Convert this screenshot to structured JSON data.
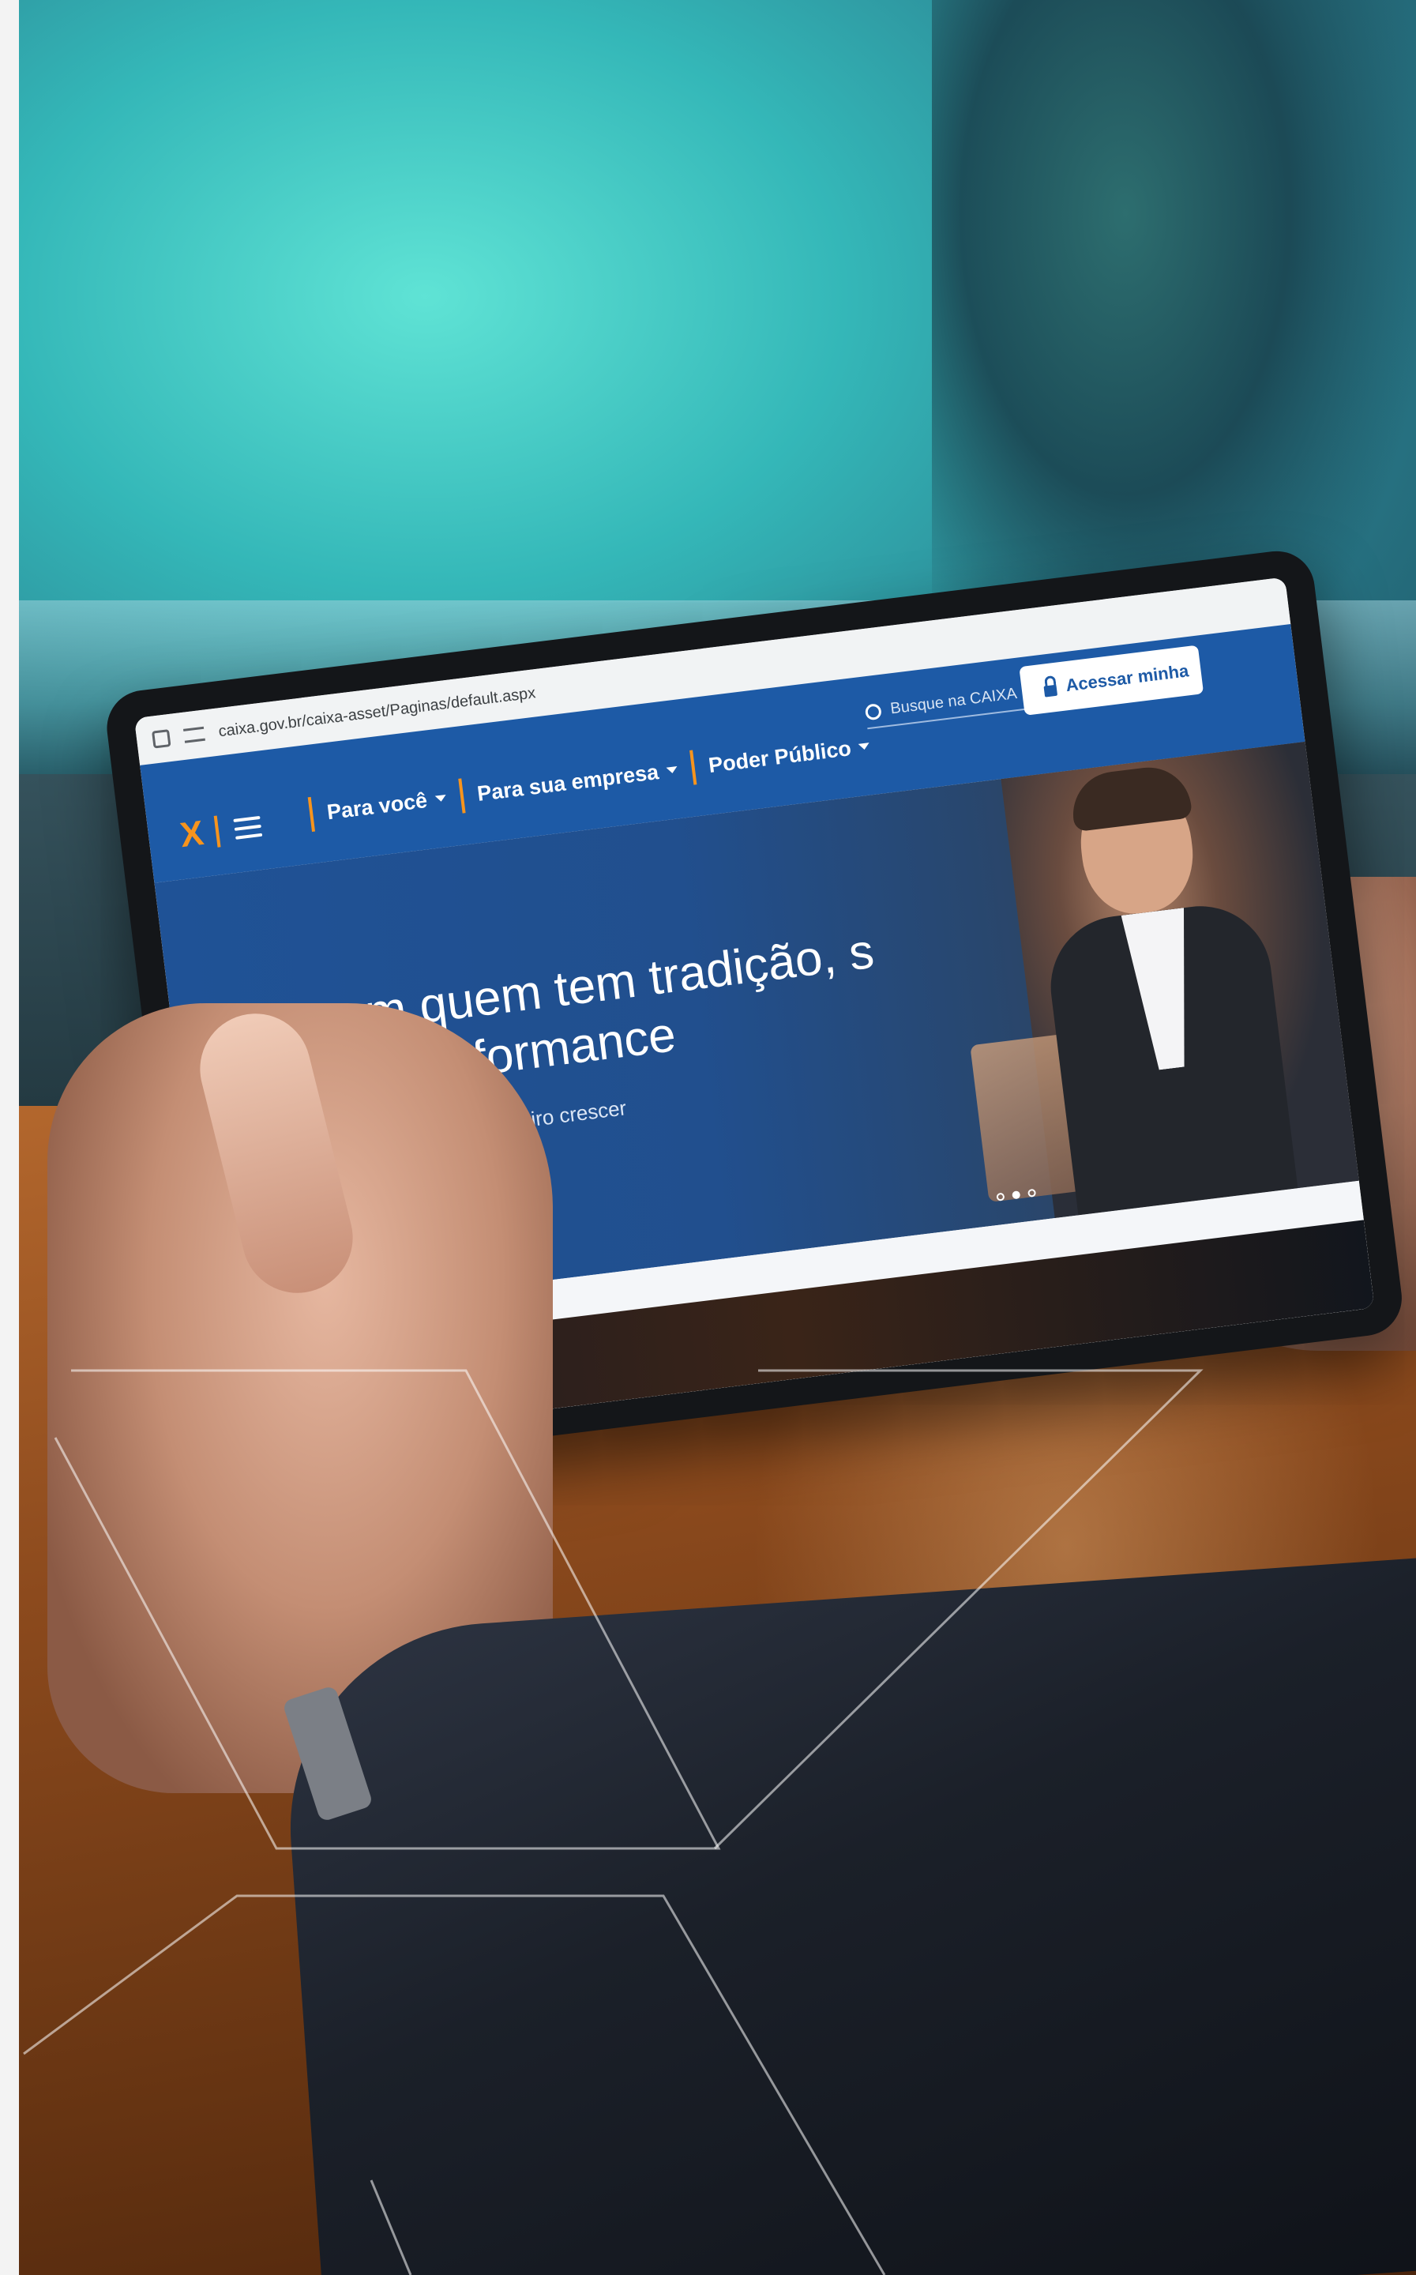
{
  "browser": {
    "url": "caixa.gov.br/caixa-asset/Paginas/default.aspx"
  },
  "site": {
    "logo_text": "X",
    "nav": [
      {
        "label": "Para você"
      },
      {
        "label": "Para sua empresa"
      },
      {
        "label": "Poder Público"
      }
    ],
    "search_placeholder": "Busque na CAIXA",
    "login_label": "Acessar minha"
  },
  "hero": {
    "title": "Inv com quem tem tradição, s ança e performance",
    "subtitle": "ima aplicação e faça seu dinheiro crescer",
    "carousel_total": 3,
    "carousel_active": 2
  },
  "colors": {
    "brand_blue": "#1d5aa6",
    "brand_orange": "#f7941d"
  },
  "icons": [
    "home-icon",
    "site-settings-icon",
    "menu-icon",
    "search-icon",
    "lock-icon",
    "chevron-down-icon"
  ]
}
